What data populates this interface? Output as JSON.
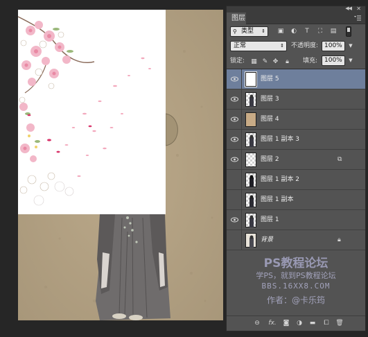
{
  "layers_panel": {
    "title": "图层",
    "collapse_icon": "double-chevron-icon",
    "close_icon": "close-icon",
    "menu_icon": "panel-menu-icon",
    "filter": {
      "kind_label": "类型",
      "icons": [
        "image-filter-icon",
        "adjustment-filter-icon",
        "type-filter-icon",
        "shape-filter-icon",
        "smart-object-filter-icon"
      ]
    },
    "blend_mode": "正常",
    "opacity_label": "不透明度:",
    "opacity_value": "100%",
    "lock_label": "锁定:",
    "lock_icons": [
      "lock-transparent-icon",
      "lock-paint-icon",
      "lock-move-icon",
      "lock-all-icon"
    ],
    "fill_label": "填充:",
    "fill_value": "100%",
    "layers": [
      {
        "name": "图层 5",
        "visible": true,
        "selected": true
      },
      {
        "name": "图层 3",
        "visible": true,
        "selected": false
      },
      {
        "name": "图层 4",
        "visible": true,
        "selected": false
      },
      {
        "name": "图层 1 副本 3",
        "visible": true,
        "selected": false
      },
      {
        "name": "图层 2",
        "visible": true,
        "selected": false,
        "badge": "smart-object-icon"
      },
      {
        "name": "图层 1 副本 2",
        "visible": false,
        "selected": false
      },
      {
        "name": "图层 1 副本",
        "visible": false,
        "selected": false
      },
      {
        "name": "图层 1",
        "visible": true,
        "selected": false
      },
      {
        "name": "背景",
        "visible": false,
        "selected": false,
        "locked": true
      }
    ],
    "bottom_icons": [
      "link-layers-icon",
      "fx-icon",
      "add-mask-icon",
      "adjustment-layer-icon",
      "group-folder-icon",
      "new-layer-icon",
      "trash-icon"
    ],
    "fx_label": "fx."
  },
  "watermark": {
    "line1": "PS教程论坛",
    "line2": "学PS，就到PS教程论坛",
    "line3": "BBS.16XX8.COM",
    "line4": "作者：@卡乐筠"
  },
  "colors": {
    "panel_bg": "#535353",
    "selected_row": "#6e7f9c",
    "canvas_paper": "#b4a384",
    "workspace": "#262626"
  }
}
